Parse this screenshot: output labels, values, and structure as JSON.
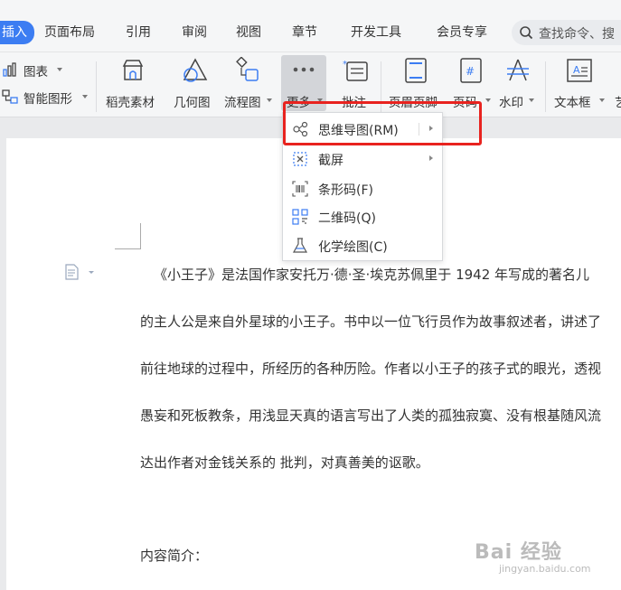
{
  "tabs": {
    "insert": "插入",
    "layout": "页面布局",
    "references": "引用",
    "review": "审阅",
    "view": "视图",
    "chapter": "章节",
    "devtools": "开发工具",
    "member": "会员专享"
  },
  "search": {
    "placeholder": "查找命令、搜"
  },
  "ribbon": {
    "chart": "图表",
    "smart_shape": "智能图形",
    "daoke": "稻壳素材",
    "geometry": "几何图",
    "flowchart": "流程图",
    "more": "更多",
    "comment": "批注",
    "header_footer": "页眉页脚",
    "page_number": "页码",
    "watermark": "水印",
    "textbox": "文本框",
    "art_partial": "艺"
  },
  "menu": {
    "items": [
      {
        "label": "思维导图(RM)",
        "icon": "mindmap-icon",
        "submenu": true
      },
      {
        "label": "截屏",
        "icon": "screenshot-icon",
        "submenu": true
      },
      {
        "label": "条形码(F)",
        "icon": "barcode-icon",
        "submenu": false
      },
      {
        "label": "二维码(Q)",
        "icon": "qrcode-icon",
        "submenu": false
      },
      {
        "label": "化学绘图(C)",
        "icon": "flask-icon",
        "submenu": false
      }
    ]
  },
  "document": {
    "lines": [
      "《小王子》是法国作家安托万·德·圣·埃克苏佩里于 1942 年写成的著名儿",
      "的主人公是来自外星球的小王子。书中以一位飞行员作为故事叙述者，讲述了",
      "前往地球的过程中，所经历的各种历险。作者以小王子的孩子式的眼光，透视",
      "愚妄和死板教条，用浅显天真的语言写出了人类的孤独寂寞、没有根基随风流",
      "达出作者对金钱关系的        批判，对真善美的讴歌。"
    ],
    "section_heading": "内容简介："
  },
  "watermark": {
    "main": "Bai  经验",
    "sub": "jingyan.baidu.com"
  },
  "colors": {
    "accent": "#3c7df2",
    "highlight": "#e8231f",
    "menu_bg": "#ffffff"
  }
}
